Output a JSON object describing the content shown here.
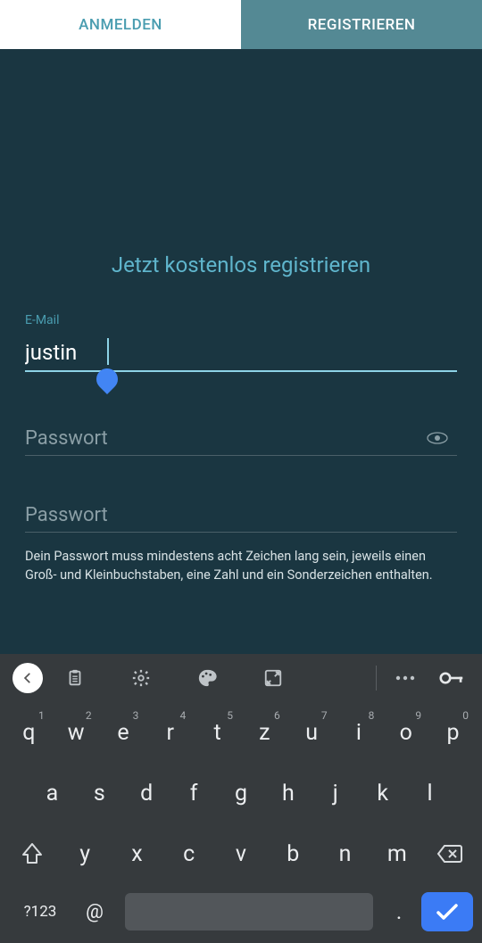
{
  "tabs": {
    "login": "ANMELDEN",
    "register": "REGISTRIEREN"
  },
  "heading": "Jetzt kostenlos registrieren",
  "fields": {
    "email": {
      "label": "E-Mail",
      "value": "justin"
    },
    "password1": {
      "placeholder": "Passwort",
      "value": ""
    },
    "password2": {
      "placeholder": "Passwort",
      "value": ""
    }
  },
  "hint": "Dein Passwort muss mindestens acht Zeichen lang sein, jeweils einen Groß- und Kleinbuchstaben, eine Zahl und ein Sonderzeichen enthalten.",
  "keyboard": {
    "row1": [
      {
        "k": "q",
        "s": "1"
      },
      {
        "k": "w",
        "s": "2"
      },
      {
        "k": "e",
        "s": "3"
      },
      {
        "k": "r",
        "s": "4"
      },
      {
        "k": "t",
        "s": "5"
      },
      {
        "k": "z",
        "s": "6"
      },
      {
        "k": "u",
        "s": "7"
      },
      {
        "k": "i",
        "s": "8"
      },
      {
        "k": "o",
        "s": "9"
      },
      {
        "k": "p",
        "s": "0"
      }
    ],
    "row2": [
      "a",
      "s",
      "d",
      "f",
      "g",
      "h",
      "j",
      "k",
      "l"
    ],
    "row3": [
      "y",
      "x",
      "c",
      "v",
      "b",
      "n",
      "m"
    ],
    "sym": "?123",
    "at": "@",
    "dot": "."
  }
}
